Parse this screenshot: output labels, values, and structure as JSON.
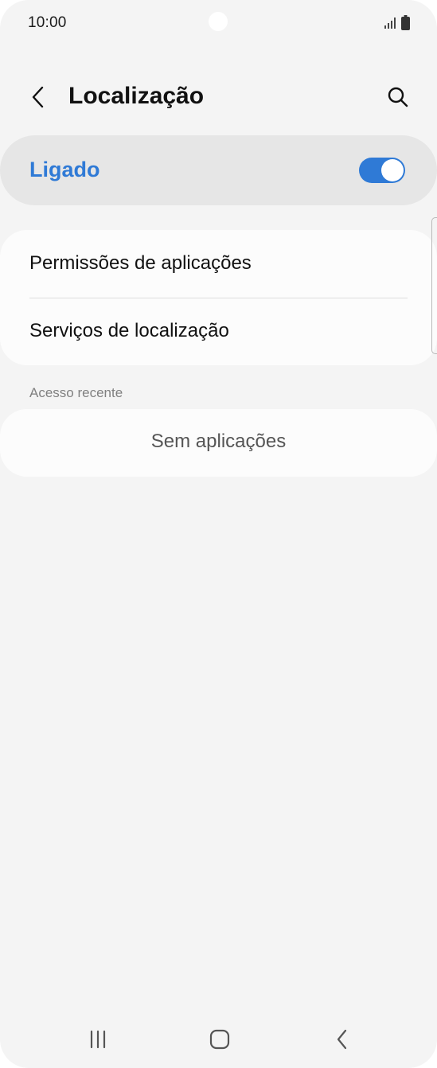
{
  "status_bar": {
    "time": "10:00",
    "icons": [
      "signal-icon",
      "battery-icon"
    ]
  },
  "header": {
    "title": "Localização",
    "back_icon": "chevron-left-icon",
    "search_icon": "search-icon"
  },
  "master_switch": {
    "label": "Ligado",
    "enabled": true,
    "accent_color": "#2f7ad6"
  },
  "settings": {
    "items": [
      {
        "label": "Permissões de aplicações"
      },
      {
        "label": "Serviços de localização"
      }
    ]
  },
  "recent_access": {
    "header": "Acesso recente",
    "empty_text": "Sem aplicações"
  },
  "nav_bar": {
    "icons": [
      "recent-apps-icon",
      "home-icon",
      "back-icon"
    ]
  }
}
